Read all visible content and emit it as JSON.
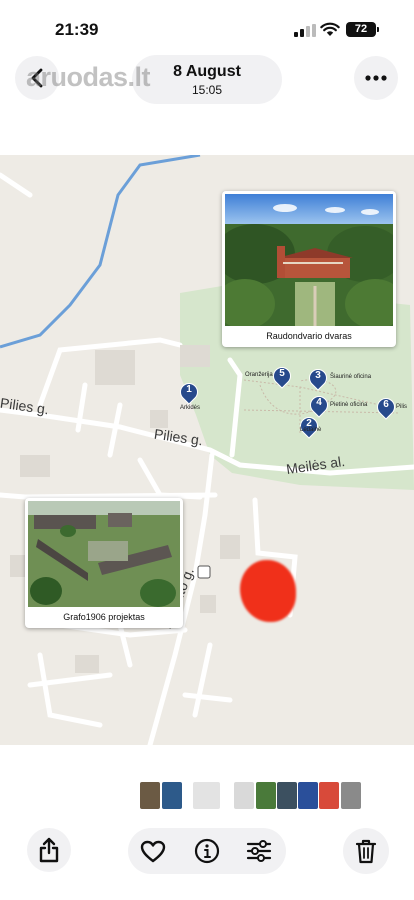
{
  "status_bar": {
    "time": "21:39",
    "battery": "72"
  },
  "header": {
    "watermark": "aruodas.lt",
    "date": "8 August",
    "time": "15:05",
    "icons": {
      "back": "chevron-left-icon",
      "more": "ellipsis-icon"
    }
  },
  "map": {
    "street_labels": [
      "Pilies g.",
      "Pilies g.",
      "Meilės al.",
      "Instituto g."
    ],
    "pois": [
      {
        "number": "1",
        "label": "Arkidės"
      },
      {
        "number": "2",
        "label": "Ledainė"
      },
      {
        "number": "3",
        "label": "Šiaurinė oficina"
      },
      {
        "number": "4",
        "label": "Pietinė oficina"
      },
      {
        "number": "5",
        "label": "Oranžerija"
      },
      {
        "number": "6",
        "label": "Pilis"
      }
    ],
    "card_top": {
      "caption": "Raudondvario dvaras"
    },
    "card_bottom": {
      "caption": "Grafo1906 projektas"
    },
    "colors": {
      "park": "#d6e6cc",
      "pin": "#274a8c",
      "marker": "#f0301a",
      "river": "#6b9fd8"
    }
  },
  "thumbnails": [
    "#6b5a44",
    "#2d5a8a",
    "#e3e3e3",
    "#d9d9d9",
    "#4a7a3a",
    "#3c5060",
    "#2a4f9a",
    "#d84a3a",
    "#8a8a8a"
  ],
  "toolbar": {
    "icons": {
      "share": "share-icon",
      "favorite": "heart-icon",
      "info": "info-icon",
      "adjust": "sliders-icon",
      "delete": "trash-icon"
    }
  }
}
